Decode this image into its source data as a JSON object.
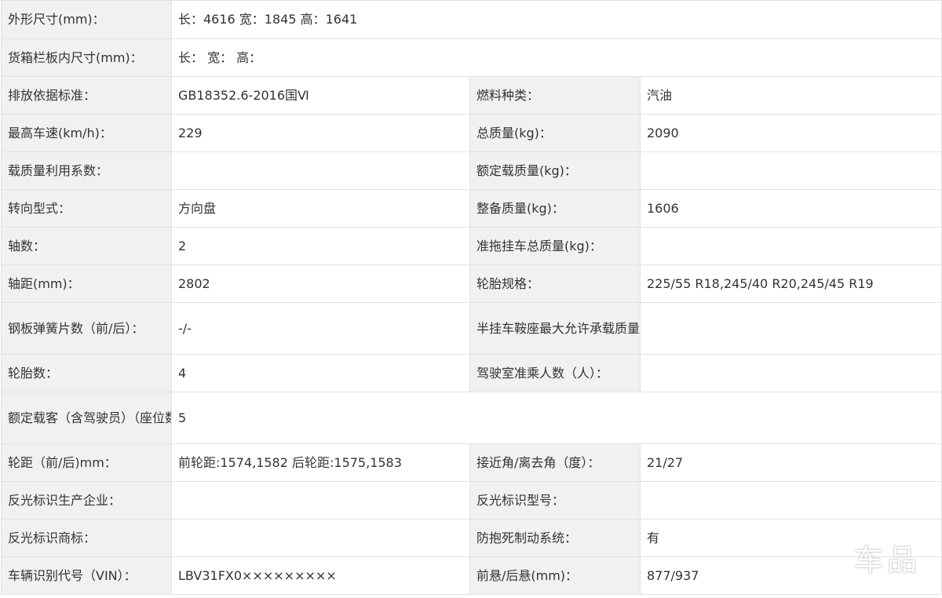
{
  "rows": [
    {
      "l1": "外形尺寸(mm)：",
      "v1": "长：4616 宽：1845 高：1641"
    },
    {
      "l1": "货箱栏板内尺寸(mm)：",
      "v1": "长： 宽： 高："
    },
    {
      "l1": "排放依据标准：",
      "v1": "GB18352.6-2016国Ⅵ",
      "l2": "燃料种类：",
      "v2": "汽油"
    },
    {
      "l1": "最高车速(km/h)：",
      "v1": "229",
      "l2": "总质量(kg)：",
      "v2": "2090"
    },
    {
      "l1": "载质量利用系数：",
      "v1": "",
      "l2": "额定载质量(kg)：",
      "v2": ""
    },
    {
      "l1": "转向型式：",
      "v1": "方向盘",
      "l2": "整备质量(kg)：",
      "v2": "1606"
    },
    {
      "l1": "轴数：",
      "v1": "2",
      "l2": "准拖挂车总质量(kg)：",
      "v2": ""
    },
    {
      "l1": "轴距(mm)：",
      "v1": "2802",
      "l2": "轮胎规格：",
      "v2": "225/55 R18,245/40 R20,245/45 R19"
    },
    {
      "l1": "钢板弹簧片数（前/后）：",
      "v1": "-/-",
      "l2": "半挂车鞍座最大允许承载质量(kg)：",
      "v2": ""
    },
    {
      "l1": "轮胎数：",
      "v1": "4",
      "l2": "驾驶室准乘人数（人）：",
      "v2": ""
    },
    {
      "l1": "额定载客（含驾驶员）（座位数）：",
      "v1": "5"
    },
    {
      "l1": "轮距（前/后)mm：",
      "v1": "前轮距:1574,1582 后轮距:1575,1583",
      "l2": "接近角/离去角（度）：",
      "v2": "21/27"
    },
    {
      "l1": "反光标识生产企业：",
      "v1": "",
      "l2": "反光标识型号：",
      "v2": ""
    },
    {
      "l1": "反光标识商标：",
      "v1": "",
      "l2": "防抱死制动系统：",
      "v2": "有"
    },
    {
      "l1": "车辆识别代号（VIN）：",
      "v1": "LBV31FX0×××××××××",
      "l2": "前悬/后悬(mm)：",
      "v2": "877/937"
    }
  ],
  "watermark": "车品"
}
